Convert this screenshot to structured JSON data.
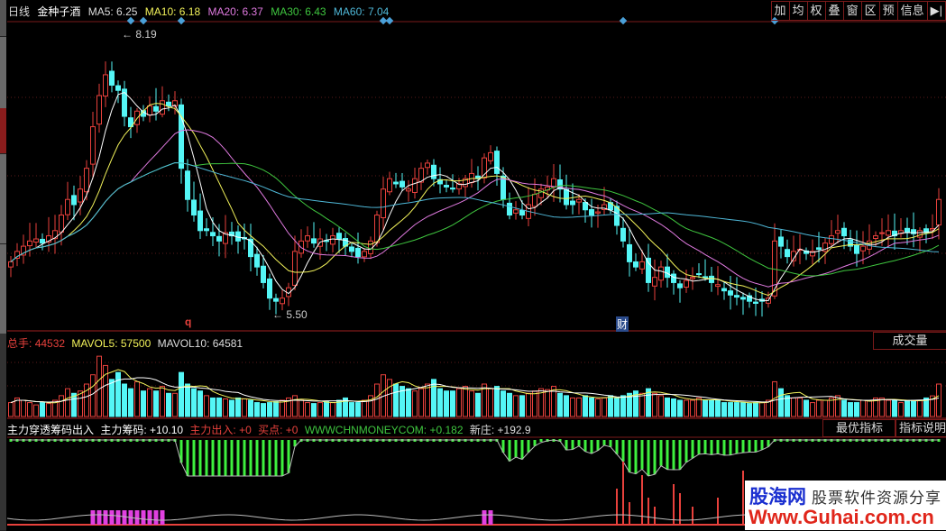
{
  "header": {
    "period": "日线",
    "stock_name": "金种子酒",
    "ma5": "MA5: 6.25",
    "ma10": "MA10: 6.18",
    "ma20": "MA20: 6.37",
    "ma30": "MA30: 6.43",
    "ma60": "MA60: 7.04"
  },
  "toolbar": [
    "加",
    "均",
    "权",
    "叠",
    "窗",
    "区",
    "预",
    "信息",
    "▶|"
  ],
  "colors": {
    "up": "#e8413c",
    "down": "#54f6f6",
    "ma5": "#ffffff",
    "ma10": "#f2f25a",
    "ma20": "#e07ae0",
    "ma30": "#3fc63f",
    "ma60": "#4fb8d8"
  },
  "price_labels": {
    "high": "8.19",
    "low": "5.50"
  },
  "markers": {
    "q": "q",
    "cai": "财"
  },
  "volume": {
    "total_label": "总手:",
    "total_value": "44532",
    "mavol5": "MAVOL5: 57500",
    "mavol10": "MAVOL10: 64581",
    "panel_button": "成交量"
  },
  "indicator": {
    "name": "主力穿透筹码出入",
    "chip": "主力筹码: +10.10",
    "flow": "主力出入: +0",
    "buy": "买点: +0",
    "site": "WWWCHNMONEYCOM: +0.182",
    "new": "新庄: +192.9",
    "best_button": "最优指标",
    "help_button": "指标说明"
  },
  "watermark": {
    "brand": "股海网",
    "slogan": "股票软件资源分享",
    "url": "Www.Guhai.com.cn"
  },
  "chart_data": {
    "type": "candlestick",
    "price_range": [
      5.5,
      8.19
    ],
    "close": [
      6.0,
      6.1,
      6.15,
      6.2,
      6.22,
      6.18,
      6.25,
      6.3,
      6.45,
      6.6,
      6.55,
      6.7,
      6.9,
      7.3,
      7.6,
      7.8,
      7.7,
      7.65,
      7.4,
      7.3,
      7.45,
      7.4,
      7.5,
      7.45,
      7.55,
      7.5,
      7.55,
      6.9,
      6.6,
      6.45,
      6.3,
      6.3,
      6.25,
      6.2,
      6.28,
      6.25,
      6.2,
      6.22,
      6.05,
      5.95,
      5.8,
      5.65,
      5.62,
      5.65,
      5.75,
      6.1,
      6.2,
      6.25,
      6.18,
      6.22,
      6.2,
      6.25,
      6.22,
      6.15,
      6.1,
      6.05,
      6.1,
      6.2,
      6.45,
      6.7,
      6.8,
      6.75,
      6.72,
      6.7,
      6.8,
      6.9,
      6.95,
      6.8,
      6.75,
      6.72,
      6.7,
      6.75,
      6.8,
      6.85,
      6.8,
      7.0,
      7.05,
      6.85,
      6.6,
      6.45,
      6.5,
      6.45,
      6.55,
      6.65,
      6.7,
      6.72,
      6.8,
      6.7,
      6.55,
      6.55,
      6.6,
      6.5,
      6.45,
      6.48,
      6.55,
      6.5,
      6.35,
      6.2,
      6.0,
      5.95,
      6.0,
      5.8,
      5.85,
      5.95,
      5.85,
      5.8,
      5.75,
      5.82,
      5.85,
      5.88,
      5.85,
      5.8,
      5.78,
      5.72,
      5.68,
      5.66,
      5.64,
      5.62,
      5.6,
      5.62,
      5.65,
      6.2,
      6.15,
      6.05,
      6.1,
      6.12,
      6.08,
      6.1,
      6.12,
      6.18,
      6.25,
      6.3,
      6.25,
      6.15,
      6.08,
      6.15,
      6.2,
      6.25,
      6.28,
      6.3,
      6.25,
      6.3,
      6.28,
      6.27,
      6.3,
      6.28,
      6.32,
      6.6
    ],
    "volume_k": [
      30,
      40,
      35,
      30,
      25,
      30,
      28,
      35,
      45,
      60,
      50,
      55,
      70,
      90,
      130,
      110,
      80,
      95,
      70,
      60,
      75,
      55,
      60,
      55,
      65,
      50,
      50,
      95,
      70,
      60,
      55,
      45,
      40,
      40,
      38,
      35,
      40,
      38,
      35,
      30,
      28,
      30,
      32,
      35,
      40,
      45,
      35,
      30,
      28,
      30,
      32,
      30,
      35,
      40,
      30,
      30,
      35,
      45,
      70,
      90,
      80,
      70,
      65,
      60,
      55,
      60,
      70,
      80,
      60,
      55,
      55,
      60,
      65,
      55,
      50,
      70,
      60,
      65,
      55,
      50,
      45,
      45,
      50,
      55,
      60,
      58,
      65,
      50,
      45,
      40,
      40,
      45,
      40,
      38,
      40,
      45,
      40,
      45,
      50,
      55,
      50,
      60,
      50,
      45,
      40,
      38,
      35,
      35,
      35,
      40,
      35,
      35,
      35,
      30,
      30,
      30,
      30,
      28,
      30,
      30,
      35,
      75,
      60,
      45,
      40,
      40,
      35,
      30,
      35,
      35,
      40,
      45,
      35,
      30,
      30,
      35,
      35,
      40,
      40,
      35,
      35,
      30,
      35,
      35,
      35,
      40,
      44.5,
      70
    ],
    "signal_diamonds": [
      19,
      21,
      27,
      59,
      60,
      97,
      121
    ],
    "flow_red": [
      [
        96,
        40
      ],
      [
        97,
        70
      ],
      [
        98,
        25
      ],
      [
        100,
        55
      ],
      [
        101,
        30
      ],
      [
        102,
        20
      ],
      [
        105,
        45
      ],
      [
        106,
        35
      ],
      [
        108,
        20
      ],
      [
        112,
        30
      ],
      [
        116,
        60
      ],
      [
        118,
        35
      ],
      [
        120,
        25
      ]
    ],
    "flow_magenta": [
      [
        13,
        1
      ],
      [
        14,
        1
      ],
      [
        15,
        1
      ],
      [
        16,
        1
      ],
      [
        17,
        1
      ],
      [
        18,
        1
      ],
      [
        19,
        1
      ],
      [
        20,
        1
      ],
      [
        21,
        1
      ],
      [
        22,
        1
      ],
      [
        23,
        1
      ],
      [
        24,
        1
      ],
      [
        75,
        1
      ],
      [
        76,
        1
      ]
    ]
  }
}
